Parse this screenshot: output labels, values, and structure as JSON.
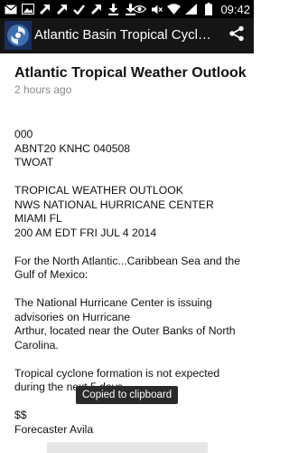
{
  "status_bar": {
    "time": "09:42",
    "left_icons": [
      "email-icon",
      "image-icon",
      "arrow-up-right-icon",
      "arrow-up-right-icon",
      "check-icon",
      "arrow-up-right-icon",
      "download-icon",
      "download-icon"
    ],
    "right_icons": [
      "eye-icon",
      "mute-icon",
      "wifi-icon",
      "signal-icon",
      "battery-icon"
    ]
  },
  "action_bar": {
    "title": "Atlantic Basin Tropical Cyclo…",
    "share_icon": "share-icon"
  },
  "article": {
    "title": "Atlantic Tropical Weather Outlook",
    "timestamp": "2 hours ago",
    "paragraphs": [
      [
        "000",
        "ABNT20 KNHC 040508",
        "TWOAT"
      ],
      [
        "TROPICAL WEATHER OUTLOOK",
        "NWS NATIONAL HURRICANE CENTER",
        "MIAMI FL",
        "200 AM EDT FRI JUL 4 2014"
      ],
      [
        "For the North Atlantic...Caribbean Sea and the Gulf of Mexico:"
      ],
      [
        "The National Hurricane Center is issuing advisories on Hurricane",
        "Arthur, located near the Outer Banks of North Carolina."
      ],
      [
        "Tropical cyclone formation is not expected during the next 5 days."
      ],
      [
        "$$",
        "Forecaster Avila"
      ]
    ]
  },
  "toast": {
    "text": "Copied to clipboard"
  },
  "colors": {
    "status_bar": "#000000",
    "action_bar": "#151515",
    "background": "#ffffff",
    "toast": "#2a2a2a"
  }
}
